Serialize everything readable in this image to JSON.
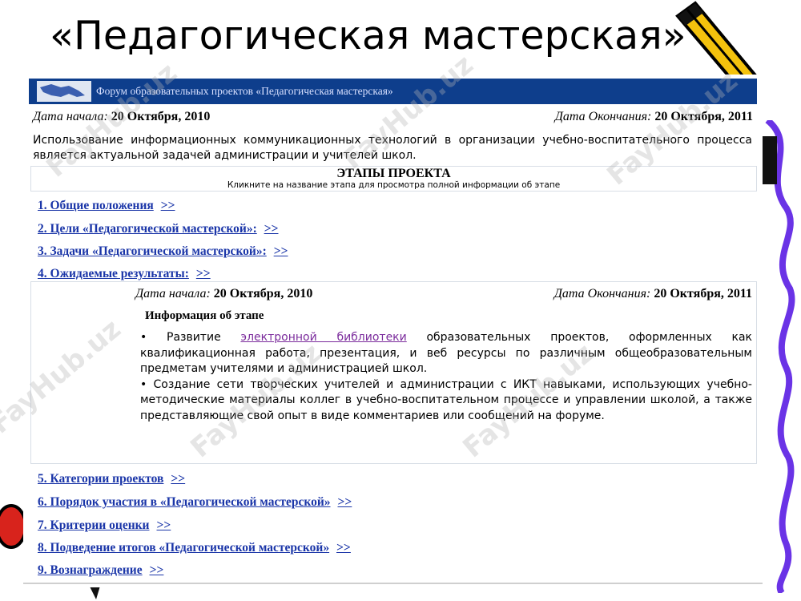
{
  "slide_title": "«Педагогическая мастерская»",
  "banner": {
    "title": "Форум образовательных проектов «Педагогическая мастерская»"
  },
  "project_dates": {
    "start_label": "Дата начала:",
    "start_value": "20 Октября, 2010",
    "end_label": "Дата Окончания:",
    "end_value": "20 Октября, 2011"
  },
  "intro_text": "Использование информационных коммуникационных технологий в организации учебно-воспитательного процесса является актуальной задачей администрации и учителей школ.",
  "stages": {
    "heading": "ЭТАПЫ ПРОЕКТА",
    "hint": "Кликните на название этапа для просмотра полной информации об этапе",
    "arrow": ">>",
    "items": [
      {
        "label": "1. Общие положения"
      },
      {
        "label": "2. Цели «Педагогической мастерской»:"
      },
      {
        "label": "3. Задачи «Педагогической мастерской»:"
      },
      {
        "label": "4. Ожидаемые результаты:"
      },
      {
        "label": "5. Категории проектов"
      },
      {
        "label": "6. Порядок участия в «Педагогической мастерской»"
      },
      {
        "label": "7. Критерии оценки"
      },
      {
        "label": "8. Подведение итогов «Педагогической мастерской»"
      },
      {
        "label": "9. Вознаграждение"
      }
    ]
  },
  "stage_detail": {
    "start_label": "Дата начала:",
    "start_value": "20 Октября, 2010",
    "end_label": "Дата Окончания:",
    "end_value": "20 Октября, 2011",
    "info_title": "Информация об этапе",
    "bullet1_prefix": "• Развитие ",
    "bullet1_link": "электронной библиотеки",
    "bullet1_suffix": " образовательных проектов, оформленных как квалификационная работа, презентация, и веб ресурсы по различным общеобразовательным предметам учителями и администрацией школ.",
    "bullet2": "• Создание сети творческих учителей и администрации с ИКТ навыками, использующих учебно-методические материалы коллег в учебно-воспитательном процессе и управлении школой, а также представляющие свой опыт в виде комментариев или сообщений на форуме."
  },
  "watermark": "FayHub.uz",
  "colors": {
    "banner": "#0e3e8c",
    "link": "#1a35a8",
    "visited_link": "#7b2b9c",
    "squiggle": "#6a33e6",
    "pencil_yellow": "#f4c20d"
  }
}
